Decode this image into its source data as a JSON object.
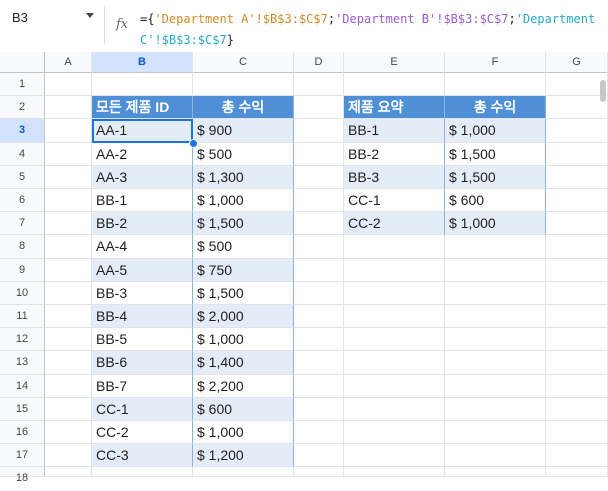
{
  "name_box": "B3",
  "formula": {
    "prefix": "={",
    "parts": [
      {
        "text": "'Department A'!$B$3:$C$7",
        "color": "#d08a27"
      },
      {
        "text": ";",
        "color": "#1f1f1f"
      },
      {
        "text": "'Department B'!$B$3:$C$7",
        "color": "#9c5bd2"
      },
      {
        "text": ";",
        "color": "#1f1f1f"
      },
      {
        "text": "'Department C'!$B$3:$C$7",
        "color": "#28a9c6"
      }
    ],
    "suffix": "}"
  },
  "fx_icon": "fx-icon",
  "columns": [
    "A",
    "B",
    "C",
    "D",
    "E",
    "F",
    "G"
  ],
  "rows": [
    "1",
    "2",
    "3",
    "4",
    "5",
    "6",
    "7",
    "8",
    "9",
    "10",
    "11",
    "12",
    "13",
    "14",
    "15",
    "16",
    "17",
    "18"
  ],
  "colors": {
    "header_bg": "#4f8fd6",
    "band_bg": "#e3ecf7",
    "selection": "#1a73e8"
  },
  "left_table": {
    "headers": [
      "모든 제품 ID",
      "총 수익"
    ],
    "rows": [
      [
        "AA-1",
        "$ 900"
      ],
      [
        "AA-2",
        "$ 500"
      ],
      [
        "AA-3",
        "$ 1,300"
      ],
      [
        "BB-1",
        "$ 1,000"
      ],
      [
        "BB-2",
        "$ 1,500"
      ],
      [
        "AA-4",
        "$ 500"
      ],
      [
        "AA-5",
        "$ 750"
      ],
      [
        "BB-3",
        "$ 1,500"
      ],
      [
        "BB-4",
        "$ 2,000"
      ],
      [
        "BB-5",
        "$ 1,000"
      ],
      [
        "BB-6",
        "$ 1,400"
      ],
      [
        "BB-7",
        "$ 2,200"
      ],
      [
        "CC-1",
        "$ 600"
      ],
      [
        "CC-2",
        "$ 1,000"
      ],
      [
        "CC-3",
        "$ 1,200"
      ]
    ]
  },
  "right_table": {
    "headers": [
      "제품 요약",
      "총 수익"
    ],
    "rows": [
      [
        "BB-1",
        "$ 1,000"
      ],
      [
        "BB-2",
        "$ 1,500"
      ],
      [
        "BB-3",
        "$ 1,500"
      ],
      [
        "CC-1",
        "$ 600"
      ],
      [
        "CC-2",
        "$ 1,000"
      ]
    ]
  }
}
